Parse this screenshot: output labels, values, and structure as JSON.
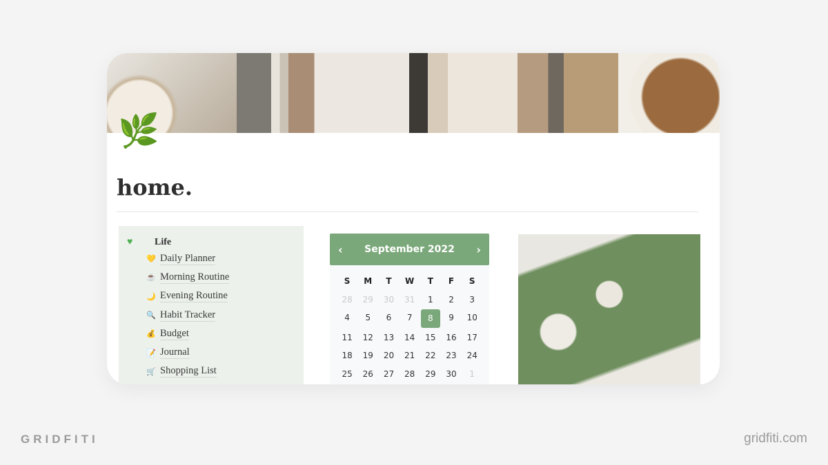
{
  "page": {
    "title": "home.",
    "icon": "seedling-branch-icon"
  },
  "panel": {
    "heading": "Life",
    "heading_icon": "green-heart-icon",
    "items": [
      {
        "label": "Daily Planner",
        "icon": "yellow-heart-icon",
        "glyph": "💛"
      },
      {
        "label": "Morning Routine",
        "icon": "coffee-icon",
        "glyph": "☕"
      },
      {
        "label": "Evening Routine",
        "icon": "moon-icon",
        "glyph": "🌙"
      },
      {
        "label": "Habit Tracker",
        "icon": "magnifier-icon",
        "glyph": "🔍"
      },
      {
        "label": "Budget",
        "icon": "money-bag-icon",
        "glyph": "💰"
      },
      {
        "label": "Journal",
        "icon": "memo-icon",
        "glyph": "📝"
      },
      {
        "label": "Shopping List",
        "icon": "cart-icon",
        "glyph": "🛒"
      }
    ]
  },
  "calendar": {
    "month": "September 2022",
    "prev": "‹",
    "next": "›",
    "accent": "#7ba87b",
    "days_of_week": [
      "S",
      "M",
      "T",
      "W",
      "T",
      "F",
      "S"
    ],
    "days": [
      [
        "28",
        "29",
        "30",
        "31",
        "1",
        "2",
        "3"
      ],
      [
        "4",
        "5",
        "6",
        "7",
        "8",
        "9",
        "10"
      ],
      [
        "11",
        "12",
        "13",
        "14",
        "15",
        "16",
        "17"
      ],
      [
        "18",
        "19",
        "20",
        "21",
        "22",
        "23",
        "24"
      ],
      [
        "25",
        "26",
        "27",
        "28",
        "29",
        "30",
        "1"
      ]
    ],
    "selected": "8"
  },
  "footer": {
    "brand": "GRIDFITI",
    "url": "gridfiti.com"
  }
}
